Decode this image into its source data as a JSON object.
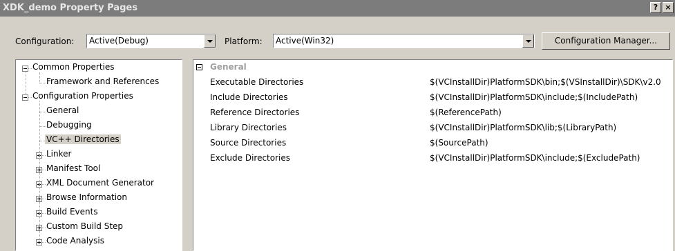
{
  "window": {
    "title": "XDK_demo Property Pages",
    "help_label": "?",
    "close_label": "×"
  },
  "toolbar": {
    "configuration_label": "Configuration:",
    "configuration_value": "Active(Debug)",
    "platform_label": "Platform:",
    "platform_value": "Active(Win32)",
    "config_manager_label": "Configuration Manager..."
  },
  "tree": {
    "items": [
      {
        "label": "Common Properties",
        "level": 0,
        "expander": "minus"
      },
      {
        "label": "Framework and References",
        "level": 1,
        "expander": null
      },
      {
        "label": "Configuration Properties",
        "level": 0,
        "expander": "minus"
      },
      {
        "label": "General",
        "level": 1,
        "expander": null
      },
      {
        "label": "Debugging",
        "level": 1,
        "expander": null
      },
      {
        "label": "VC++ Directories",
        "level": 1,
        "expander": null,
        "selected": true
      },
      {
        "label": "Linker",
        "level": 1,
        "expander": "plus"
      },
      {
        "label": "Manifest Tool",
        "level": 1,
        "expander": "plus"
      },
      {
        "label": "XML Document Generator",
        "level": 1,
        "expander": "plus"
      },
      {
        "label": "Browse Information",
        "level": 1,
        "expander": "plus"
      },
      {
        "label": "Build Events",
        "level": 1,
        "expander": "plus"
      },
      {
        "label": "Custom Build Step",
        "level": 1,
        "expander": "plus"
      },
      {
        "label": "Code Analysis",
        "level": 1,
        "expander": "plus"
      }
    ]
  },
  "grid": {
    "section_title": "General",
    "rows": [
      {
        "name": "Executable Directories",
        "value": "$(VCInstallDir)PlatformSDK\\bin;$(VSInstallDir)\\SDK\\v2.0"
      },
      {
        "name": "Include Directories",
        "value": "$(VCInstallDir)PlatformSDK\\include;$(IncludePath)"
      },
      {
        "name": "Reference Directories",
        "value": "$(ReferencePath)"
      },
      {
        "name": "Library Directories",
        "value": "$(VCInstallDir)PlatformSDK\\lib;$(LibraryPath)"
      },
      {
        "name": "Source Directories",
        "value": "$(SourcePath)"
      },
      {
        "name": "Exclude Directories",
        "value": "$(VCInstallDir)PlatformSDK\\include;$(ExcludePath)"
      }
    ]
  }
}
